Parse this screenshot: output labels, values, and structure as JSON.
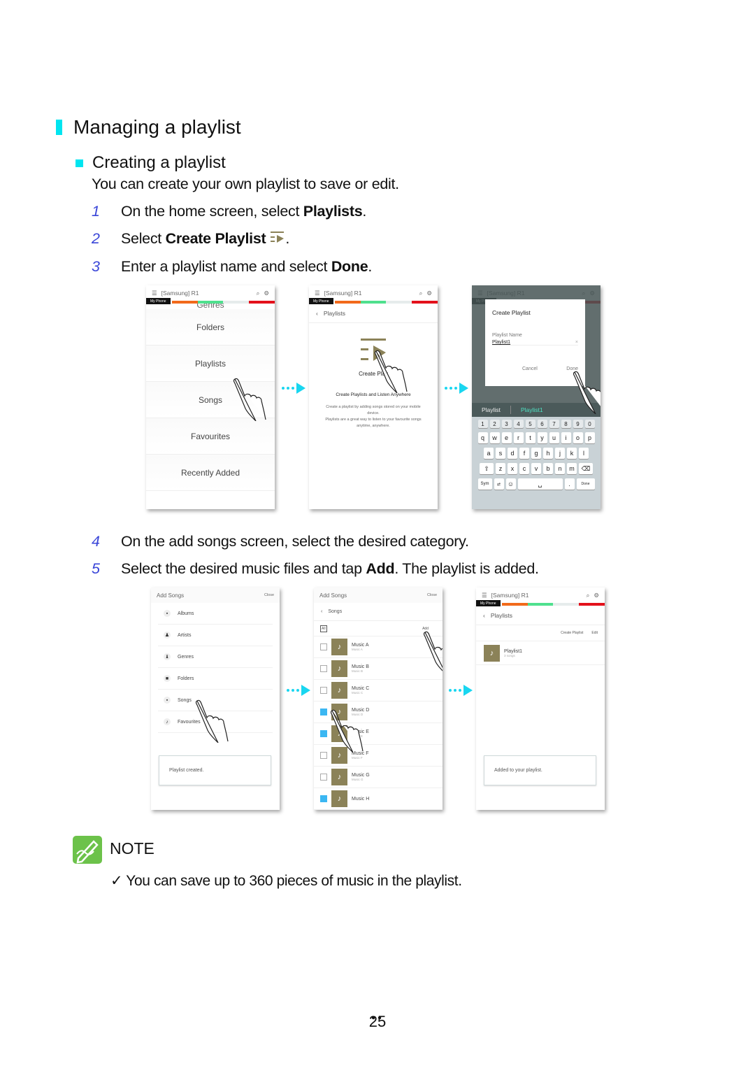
{
  "heading": "Managing a playlist",
  "subheading": "Creating a playlist",
  "intro": "You can create your own playlist to save or edit.",
  "steps": [
    {
      "num": "1",
      "pre": "On the home screen, select ",
      "bold": "Playlists",
      "post": "."
    },
    {
      "num": "2",
      "pre": "Select ",
      "bold": "Create Playlist",
      "post": ".",
      "icon": "create-playlist-icon"
    },
    {
      "num": "3",
      "pre": "Enter a playlist name and select ",
      "bold": "Done",
      "post": "."
    },
    {
      "num": "4",
      "pre": "On the add songs screen, select the desired category.",
      "bold": "",
      "post": ""
    },
    {
      "num": "5",
      "pre": "Select the desired music files and tap ",
      "bold": "Add",
      "post": ". The playlist is added."
    }
  ],
  "colors": {
    "accent": "#00e5f0",
    "step_number": "#3a46d8",
    "thumb": "#8b8258",
    "check": "#3bb7f2",
    "note_green": "#6cc24a",
    "tabs": [
      "#ffffff",
      "#f26a1b",
      "#4fe08e",
      "#e6ecec",
      "#e3111b"
    ]
  },
  "app": {
    "title": "[Samsung] R1",
    "my_phone": "My Phone"
  },
  "screen1": {
    "partial_item": "Genres",
    "items": [
      "Folders",
      "Playlists",
      "Songs",
      "Favourites",
      "Recently Added"
    ]
  },
  "screen2": {
    "back": "Playlists",
    "create_label": "Create Play",
    "headline": "Create Playlists and Listen Anywhere",
    "desc1": "Create a playlist by adding songs stored on your mobile device.",
    "desc2": "Playlists are a great way to listen to your favourite songs anytime, anywhere."
  },
  "screen3": {
    "dialog_title": "Create Playlist",
    "field_label": "Playlist Name",
    "field_value": "Playlist1",
    "cancel": "Cancel",
    "done": "Done",
    "suggest1": "Playlist",
    "suggest2": "Playlist1",
    "keys_num": [
      "1",
      "2",
      "3",
      "4",
      "5",
      "6",
      "7",
      "8",
      "9",
      "0"
    ],
    "keys_row1": [
      "q",
      "w",
      "e",
      "r",
      "t",
      "y",
      "u",
      "i",
      "o",
      "p"
    ],
    "keys_row2": [
      "a",
      "s",
      "d",
      "f",
      "g",
      "h",
      "j",
      "k",
      "l"
    ],
    "keys_row3": [
      "z",
      "x",
      "c",
      "v",
      "b",
      "n",
      "m"
    ],
    "sym": "Sym",
    "kbd_done": "Done"
  },
  "screen4": {
    "title": "Add Songs",
    "close": "Close",
    "items": [
      {
        "label": "Albums",
        "icon": "album-icon"
      },
      {
        "label": "Artists",
        "icon": "artist-icon"
      },
      {
        "label": "Genres",
        "icon": "genre-icon"
      },
      {
        "label": "Folders",
        "icon": "folder-icon"
      },
      {
        "label": "Songs",
        "icon": "song-icon"
      },
      {
        "label": "Favourites",
        "icon": "favourite-icon"
      }
    ],
    "toast": "Playlist created."
  },
  "screen5": {
    "title": "Add Songs",
    "close": "Close",
    "back": "Songs",
    "all": "All",
    "add": "Add",
    "songs": [
      {
        "name": "Music A",
        "sub": "Music A",
        "checked": false
      },
      {
        "name": "Music B",
        "sub": "Music B",
        "checked": false
      },
      {
        "name": "Music C",
        "sub": "Music C",
        "checked": false
      },
      {
        "name": "Music D",
        "sub": "Music D",
        "checked": true
      },
      {
        "name": "Music E",
        "sub": "Music E",
        "checked": true
      },
      {
        "name": "Music F",
        "sub": "Music F",
        "checked": false
      },
      {
        "name": "Music G",
        "sub": "Music G",
        "checked": false
      },
      {
        "name": "Music H",
        "sub": "",
        "checked": true
      }
    ]
  },
  "screen6": {
    "back": "Playlists",
    "create": "Create Playlist",
    "edit": "Edit",
    "playlist_name": "Playlist1",
    "playlist_sub": "3 songs",
    "toast": "Added to your playlist."
  },
  "note": {
    "title": "NOTE",
    "check": "✓",
    "text": "You can save up to 360 pieces of music in the playlist."
  },
  "page_number": "25"
}
